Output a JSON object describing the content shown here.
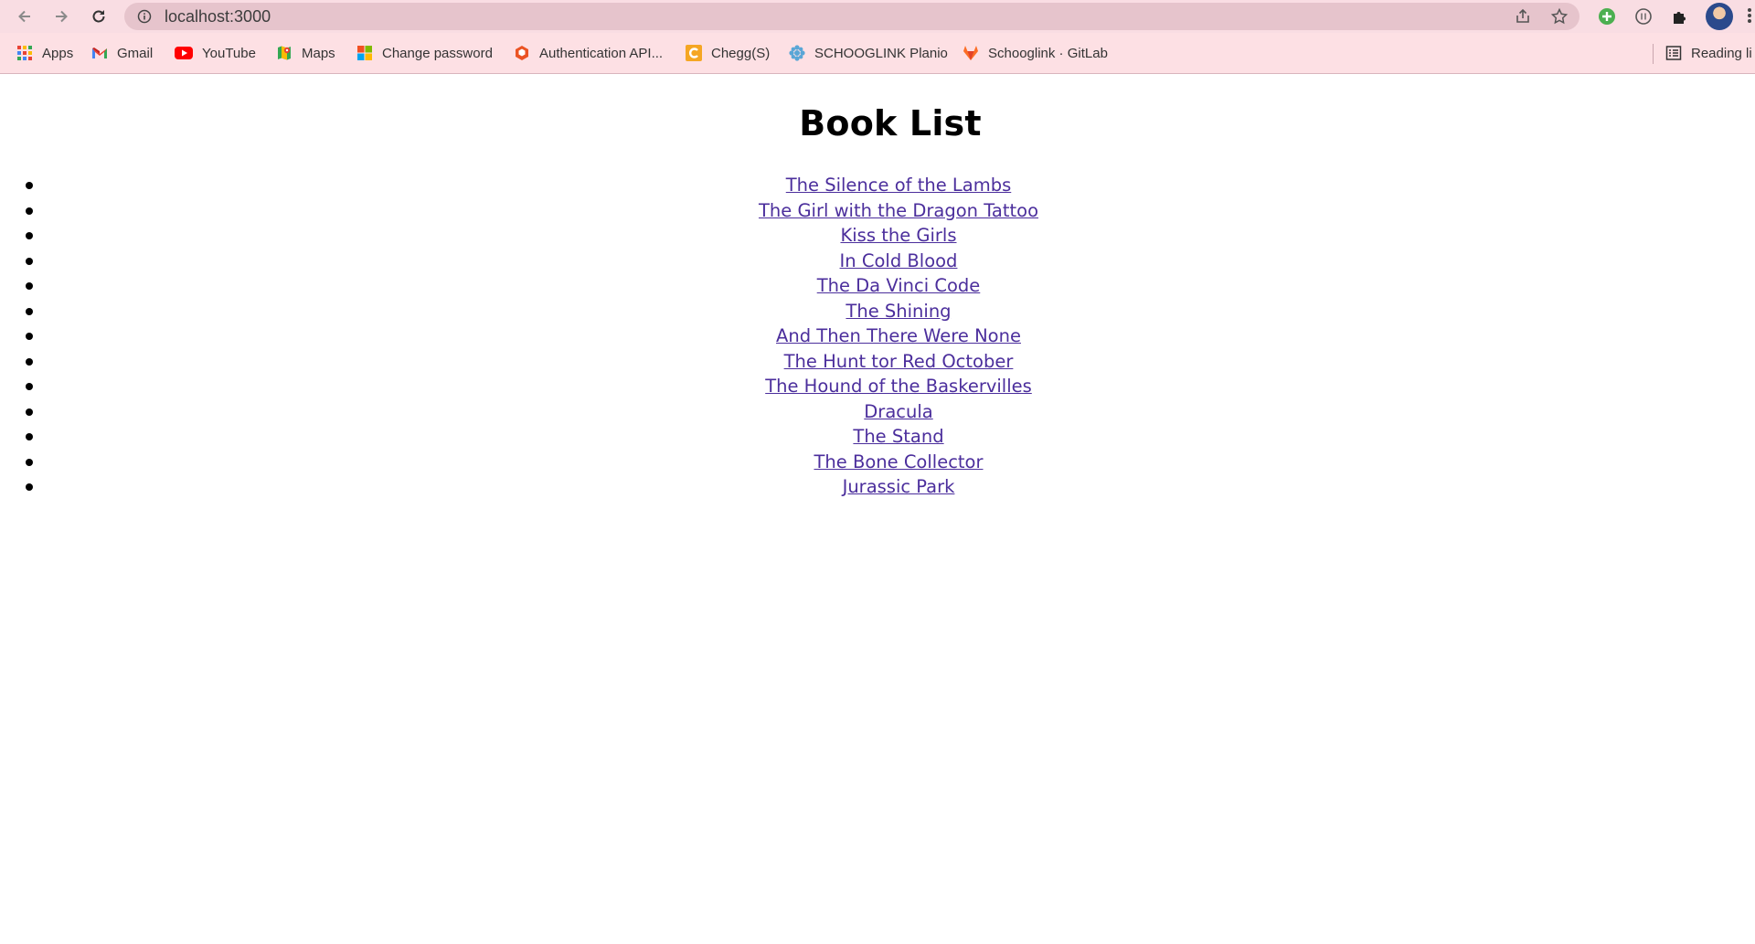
{
  "browser": {
    "url": "localhost:3000",
    "bookmarks": [
      {
        "label": "Apps",
        "icon": "apps-grid-icon"
      },
      {
        "label": "Gmail",
        "icon": "gmail-icon"
      },
      {
        "label": "YouTube",
        "icon": "youtube-icon"
      },
      {
        "label": "Maps",
        "icon": "maps-icon"
      },
      {
        "label": "Change password",
        "icon": "microsoft-icon"
      },
      {
        "label": "Authentication API...",
        "icon": "auth-api-icon"
      },
      {
        "label": "Chegg(S)",
        "icon": "chegg-icon"
      },
      {
        "label": "SCHOOGLINK Planio",
        "icon": "planio-icon"
      },
      {
        "label": "Schooglink · GitLab",
        "icon": "gitlab-icon"
      }
    ],
    "reading_list": "Reading li"
  },
  "page": {
    "title": "Book List",
    "books": [
      "The Silence of the Lambs",
      "The Girl with the Dragon Tattoo",
      "Kiss the Girls",
      "In Cold Blood",
      "The Da Vinci Code",
      "The Shining",
      "And Then There Were None",
      "The Hunt tor Red October",
      "The Hound of the Baskervilles",
      "Dracula",
      "The Stand",
      "The Bone Collector",
      "Jurassic Park"
    ]
  },
  "colors": {
    "toolbar_bg": "#f9dde3",
    "omnibox_bg": "#e6c4cc",
    "bookmarks_bg": "#fde0e4",
    "link": "#4b2e9c"
  }
}
